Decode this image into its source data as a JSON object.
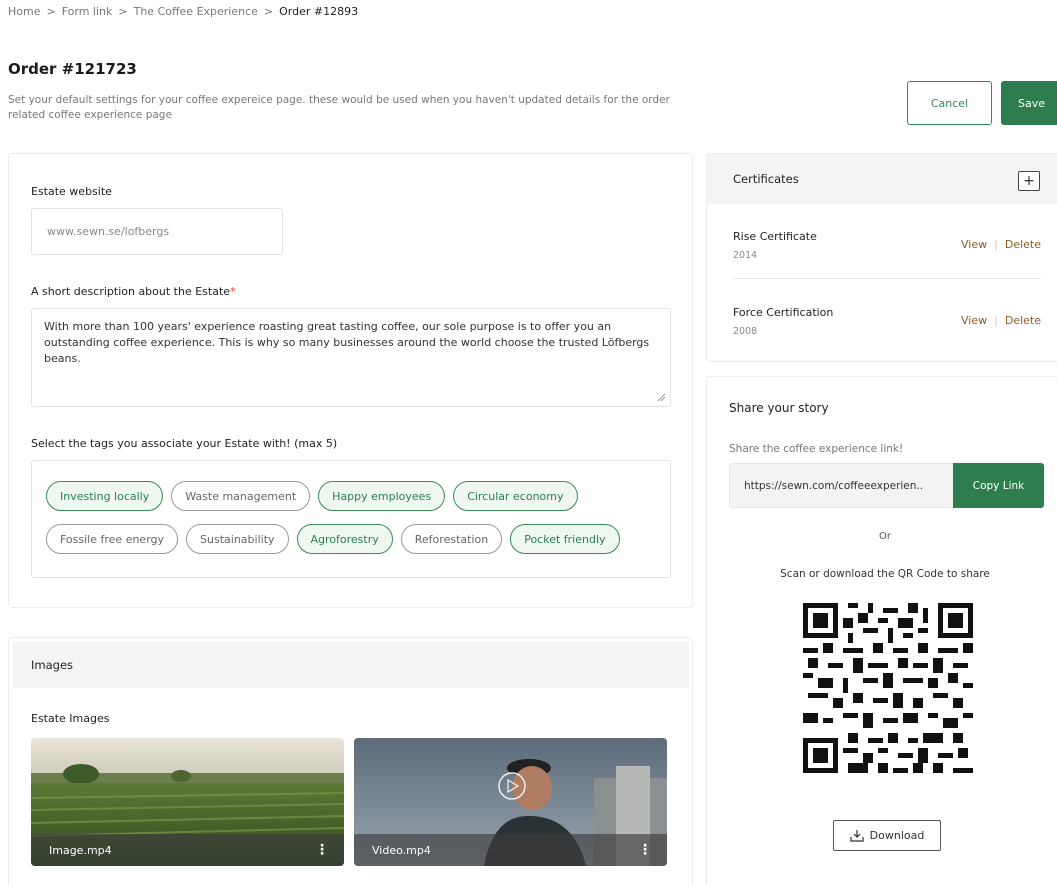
{
  "breadcrumb": {
    "items": [
      "Home",
      "Form link",
      "The Coffee Experience"
    ],
    "current": "Order #12893",
    "separator": ">"
  },
  "header": {
    "title": "Order #121723",
    "description": "Set your default settings for your coffee expereice page. these would be used when you haven't updated details for the order related coffee experience page",
    "cancel_label": "Cancel",
    "save_label": "Save"
  },
  "estate": {
    "website_label": "Estate website",
    "website_value": "www.sewn.se/lofbergs",
    "description_label": "A short description about the Estate",
    "required_mark": "*",
    "description_value": "With more than 100 years' experience roasting great tasting coffee, our sole purpose is to offer you an outstanding coffee experience. This is why so many businesses around the world choose the trusted Löfbergs beans.",
    "tags_label": "Select the tags you associate your Estate with! (max 5)",
    "tags": [
      {
        "label": "Investing locally",
        "selected": true
      },
      {
        "label": "Waste management",
        "selected": false
      },
      {
        "label": "Happy employees",
        "selected": true
      },
      {
        "label": "Circular economy",
        "selected": true
      },
      {
        "label": "Fossile free energy",
        "selected": false
      },
      {
        "label": "Sustainability",
        "selected": false
      },
      {
        "label": "Agroforestry",
        "selected": true
      },
      {
        "label": "Reforestation",
        "selected": false
      },
      {
        "label": "Pocket friendly",
        "selected": true
      }
    ]
  },
  "images": {
    "header": "Images",
    "estate_label": "Estate Images",
    "items": [
      {
        "name": "Image.mp4"
      },
      {
        "name": "Video.mp4"
      }
    ]
  },
  "certificates": {
    "header": "Certificates",
    "add_icon": "+",
    "view_label": "View",
    "delete_label": "Delete",
    "items": [
      {
        "name": "Rise Certificate",
        "year": "2014"
      },
      {
        "name": "Force Certification",
        "year": "2008"
      }
    ]
  },
  "share": {
    "title": "Share your story",
    "subtitle": "Share the coffee experience link!",
    "link_value": "https://sewn.com/coffeeexperien..",
    "copy_label": "Copy Link",
    "or_label": "Or",
    "scan_label": "Scan or download the QR Code to share",
    "download_label": "Download"
  },
  "colors": {
    "accent": "#2e7d4f",
    "link_brown": "#8b5a2b",
    "required": "#e03b3b"
  },
  "icons": {
    "download": "download-icon",
    "play": "play-icon",
    "kebab": "kebab-menu-icon",
    "add": "plus-icon",
    "qr": "qr-code"
  }
}
